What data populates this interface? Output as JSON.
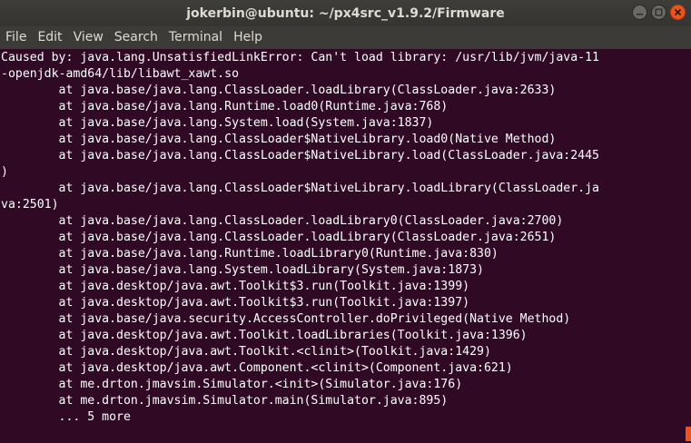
{
  "window": {
    "title": "jokerbin@ubuntu: ~/px4src_v1.9.2/Firmware"
  },
  "menu": {
    "items": [
      {
        "label": "File"
      },
      {
        "label": "Edit"
      },
      {
        "label": "View"
      },
      {
        "label": "Search"
      },
      {
        "label": "Terminal"
      },
      {
        "label": "Help"
      }
    ]
  },
  "terminal": {
    "lines": [
      "Caused by: java.lang.UnsatisfiedLinkError: Can't load library: /usr/lib/jvm/java-11",
      "-openjdk-amd64/lib/libawt_xawt.so",
      "        at java.base/java.lang.ClassLoader.loadLibrary(ClassLoader.java:2633)",
      "        at java.base/java.lang.Runtime.load0(Runtime.java:768)",
      "        at java.base/java.lang.System.load(System.java:1837)",
      "        at java.base/java.lang.ClassLoader$NativeLibrary.load0(Native Method)",
      "        at java.base/java.lang.ClassLoader$NativeLibrary.load(ClassLoader.java:2445",
      ")",
      "        at java.base/java.lang.ClassLoader$NativeLibrary.loadLibrary(ClassLoader.ja",
      "va:2501)",
      "        at java.base/java.lang.ClassLoader.loadLibrary0(ClassLoader.java:2700)",
      "        at java.base/java.lang.ClassLoader.loadLibrary(ClassLoader.java:2651)",
      "        at java.base/java.lang.Runtime.loadLibrary0(Runtime.java:830)",
      "        at java.base/java.lang.System.loadLibrary(System.java:1873)",
      "        at java.desktop/java.awt.Toolkit$3.run(Toolkit.java:1399)",
      "        at java.desktop/java.awt.Toolkit$3.run(Toolkit.java:1397)",
      "        at java.base/java.security.AccessController.doPrivileged(Native Method)",
      "        at java.desktop/java.awt.Toolkit.loadLibraries(Toolkit.java:1396)",
      "        at java.desktop/java.awt.Toolkit.<clinit>(Toolkit.java:1429)",
      "        at java.desktop/java.awt.Component.<clinit>(Component.java:621)",
      "        at me.drton.jmavsim.Simulator.<init>(Simulator.java:176)",
      "        at me.drton.jmavsim.Simulator.main(Simulator.java:895)",
      "        ... 5 more"
    ]
  },
  "colors": {
    "background": "#300a24",
    "titlebar": "#3c3b37",
    "text": "#ffffff",
    "accent": "#e95420"
  },
  "icons": {
    "minimize": "minimize-icon",
    "maximize": "maximize-icon",
    "close": "close-icon"
  }
}
